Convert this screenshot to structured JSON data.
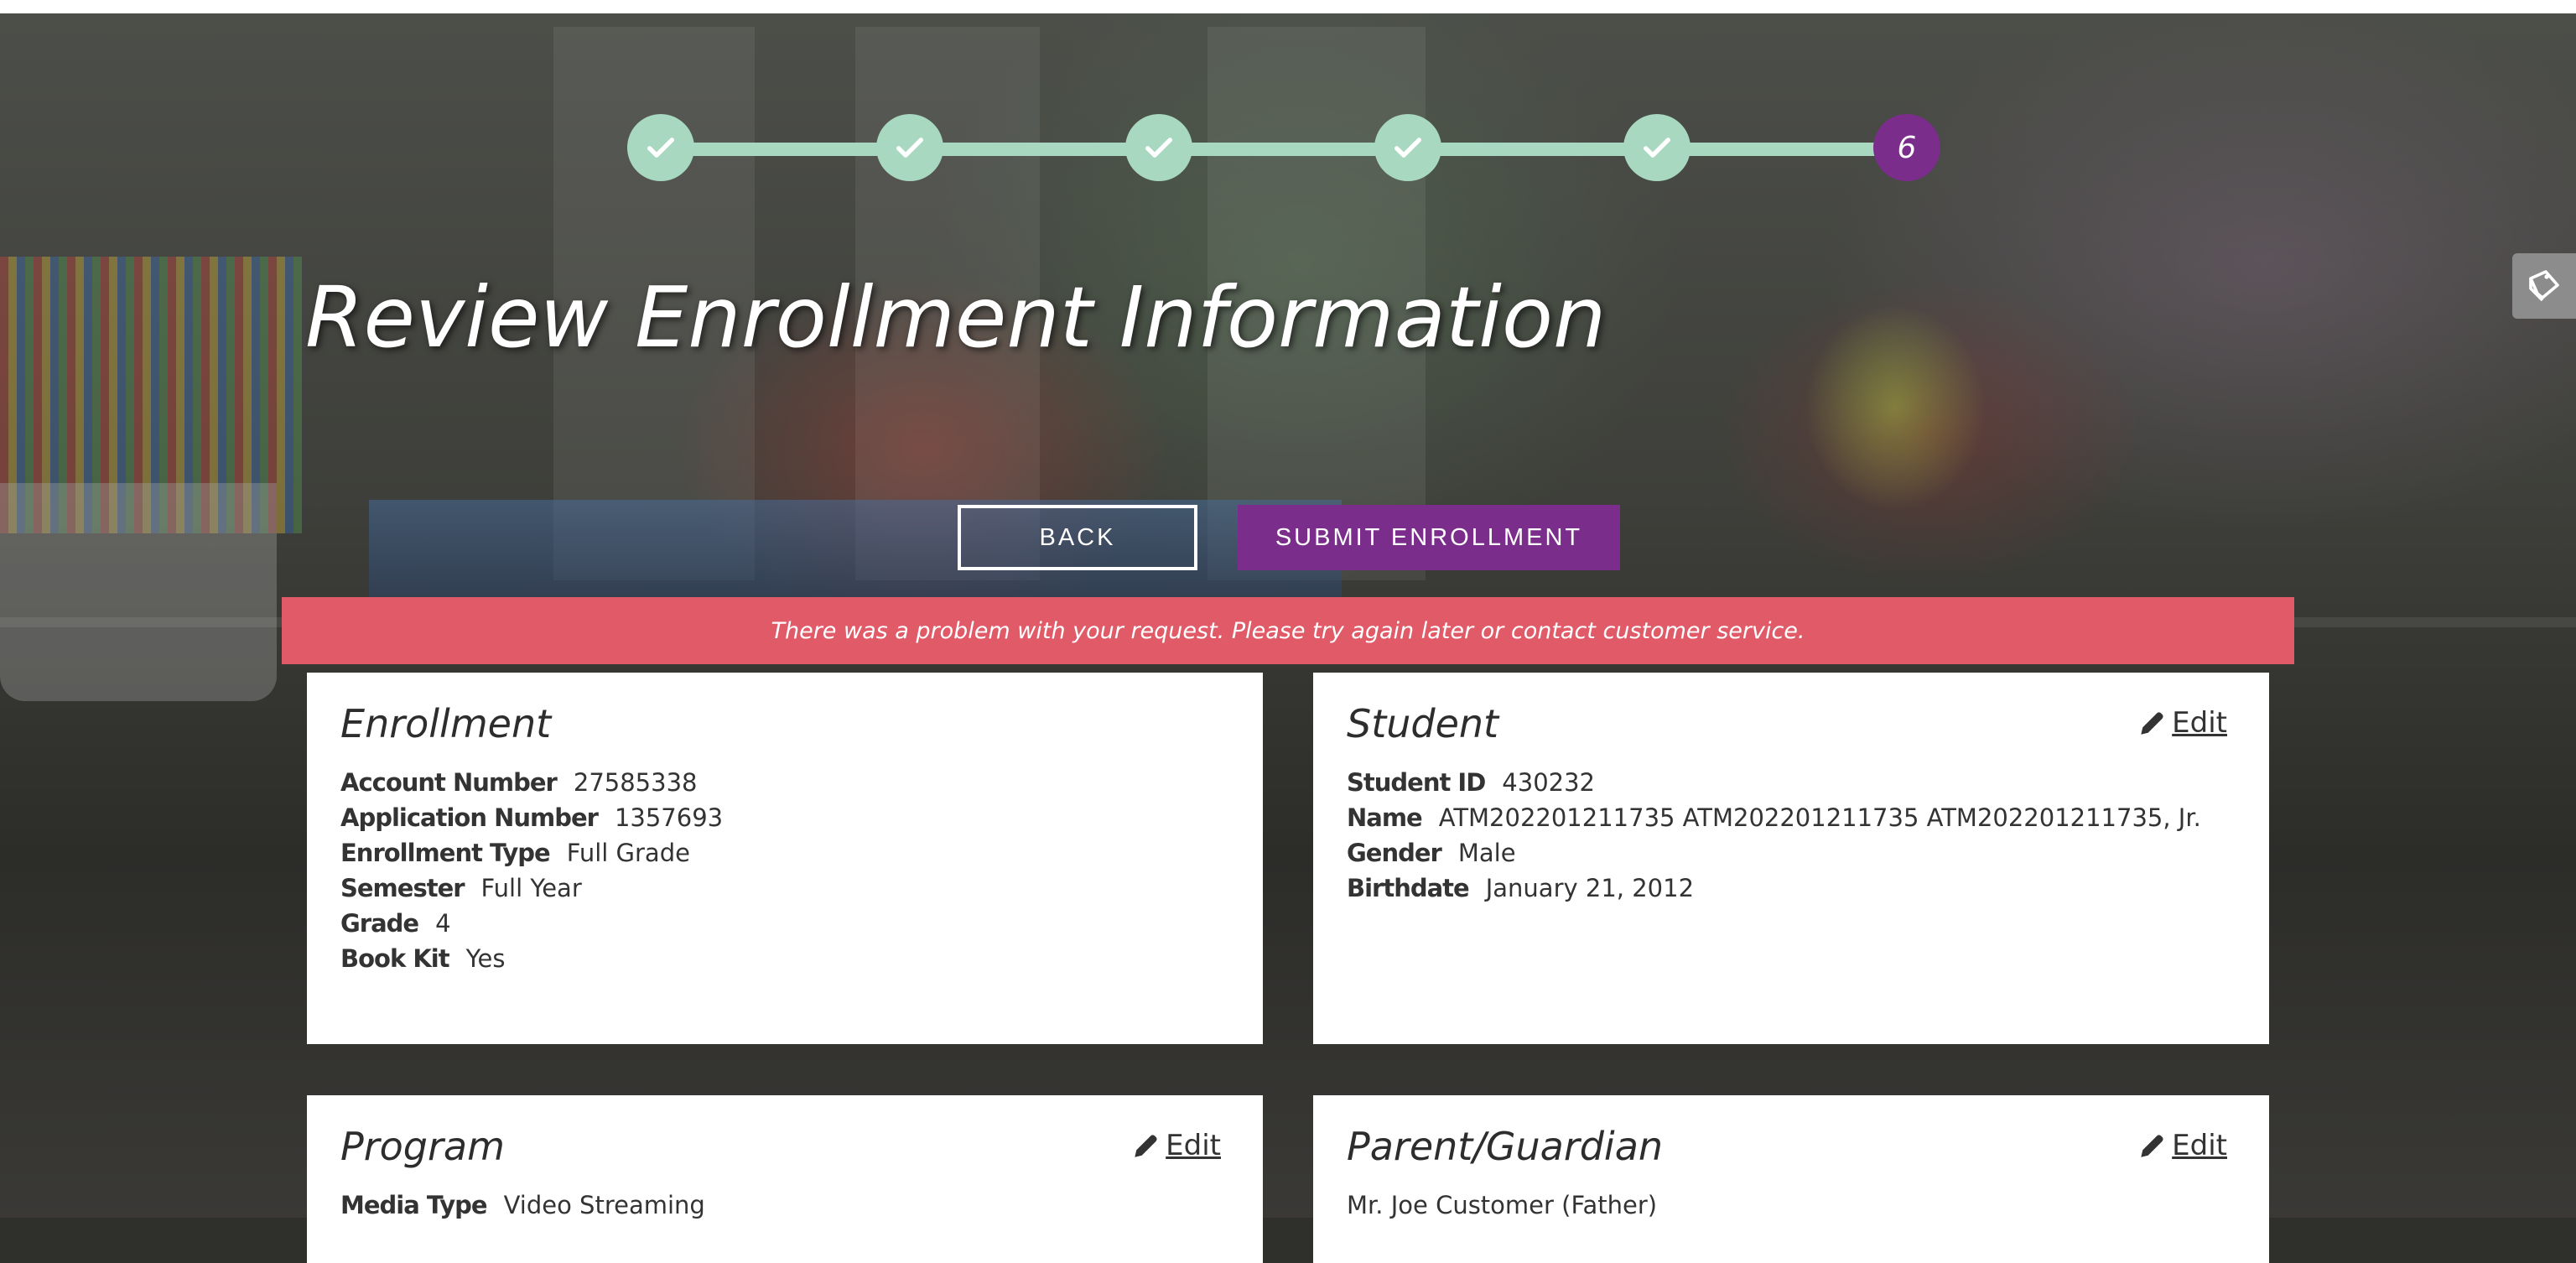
{
  "stepper": {
    "steps": [
      {
        "state": "complete",
        "icon": "check-icon"
      },
      {
        "state": "complete",
        "icon": "check-icon"
      },
      {
        "state": "complete",
        "icon": "check-icon"
      },
      {
        "state": "complete",
        "icon": "check-icon"
      },
      {
        "state": "complete",
        "icon": "check-icon"
      },
      {
        "state": "current",
        "label": "6"
      }
    ],
    "complete_color": "#a8d8c0",
    "current_color": "#7b2d8b"
  },
  "page": {
    "title": "Review Enrollment Information"
  },
  "actions": {
    "back_label": "BACK",
    "submit_label": "SUBMIT ENROLLMENT"
  },
  "alert": {
    "message": "There was a problem with your request. Please try again later or contact customer service.",
    "color": "#e05a68"
  },
  "cards": {
    "enrollment": {
      "title": "Enrollment",
      "fields": [
        {
          "label": "Account Number",
          "value": "27585338"
        },
        {
          "label": "Application Number",
          "value": "1357693"
        },
        {
          "label": "Enrollment Type",
          "value": "Full Grade"
        },
        {
          "label": "Semester",
          "value": "Full Year"
        },
        {
          "label": "Grade",
          "value": "4"
        },
        {
          "label": "Book Kit",
          "value": "Yes"
        }
      ]
    },
    "student": {
      "title": "Student",
      "edit_label": "Edit",
      "fields": [
        {
          "label": "Student ID",
          "value": "430232"
        },
        {
          "label": "Name",
          "value": "ATM202201211735 ATM202201211735 ATM202201211735, Jr."
        },
        {
          "label": "Gender",
          "value": "Male"
        },
        {
          "label": "Birthdate",
          "value": "January 21, 2012"
        }
      ]
    },
    "program": {
      "title": "Program",
      "edit_label": "Edit",
      "fields": [
        {
          "label": "Media Type",
          "value": "Video Streaming"
        }
      ]
    },
    "parent": {
      "title": "Parent/Guardian",
      "edit_label": "Edit",
      "name": "Mr. Joe Customer (Father)"
    }
  },
  "colors": {
    "brand_purple": "#7b2d8b",
    "card_bg": "#ffffff"
  }
}
